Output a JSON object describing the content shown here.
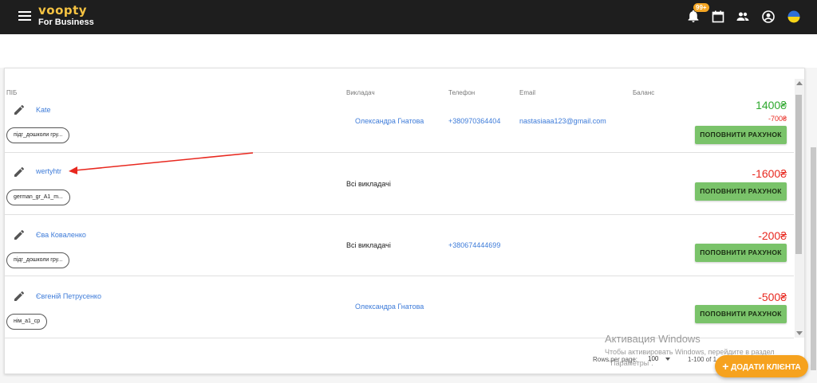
{
  "header": {
    "logo": "voopty",
    "subtitle": "For Business",
    "notification_badge": "99+",
    "icons": [
      "menu-icon",
      "bell-icon",
      "calendar-icon",
      "people-icon",
      "account-icon",
      "ukraine-flag-icon"
    ]
  },
  "table": {
    "columns": {
      "name": "ПІБ",
      "teacher": "Викладач",
      "phone": "Телефон",
      "email": "Email",
      "balance": "Баланс"
    },
    "rows": [
      {
        "name": "Kate",
        "group": "підг_дошколи гру...",
        "teacher": "Олександра Гнатова",
        "phone": "+380970364404",
        "email": "nastasiaaa123@gmail.com",
        "balance_main": "1400₴",
        "balance_secondary": "-700₴",
        "topup_label": "ПОПОВНИТИ РАХУНОК"
      },
      {
        "name": "wertyhtr",
        "group": "german_gr_A1_m...",
        "teacher": "Всі викладачі",
        "phone": "",
        "email": "",
        "balance_main": "-1600₴",
        "topup_label": "ПОПОВНИТИ РАХУНОК"
      },
      {
        "name": "Єва Коваленко",
        "group": "підг_дошколи гру...",
        "teacher": "Всі викладачі",
        "phone": "+380674444699",
        "email": "",
        "balance_main": "-200₴",
        "topup_label": "ПОПОВНИТИ РАХУНОК"
      },
      {
        "name": "Євгеній Петрусенко",
        "group": "нім_а1_ср",
        "teacher": "Олександра Гнатова",
        "phone": "",
        "email": "",
        "balance_main": "-500₴",
        "topup_label": "ПОПОВНИТИ РАХУНОК"
      }
    ]
  },
  "footer": {
    "rows_per_page_label": "Rows per page:",
    "rows_per_page_value": "100",
    "range": "1-100 of 1",
    "add_client_label": "ДОДАТИ КЛІЄНТА"
  },
  "watermark": {
    "line1": "Активация Windows",
    "line2": "Чтобы активировать Windows, перейдите в раздел",
    "line3": "\"Параметры\"."
  },
  "colors": {
    "topbar": "#1e1e1e",
    "accent": "#f6a21e",
    "topup": "#7ac36a",
    "negative": "#e8281f",
    "positive": "#2ea82e",
    "link": "#3d7bd9"
  }
}
